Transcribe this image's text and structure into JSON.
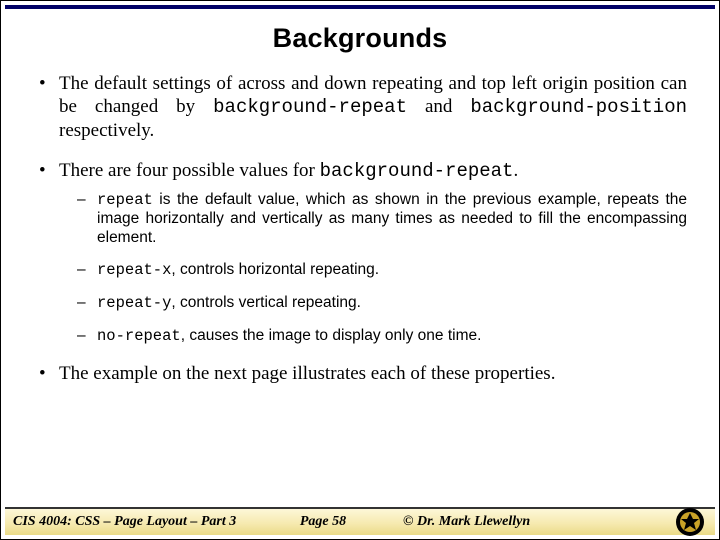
{
  "title": "Backgrounds",
  "bullets": {
    "b1": {
      "pre": "The default settings of across and down repeating and top left origin position can be changed by ",
      "code1": "background-repeat",
      "mid": " and ",
      "code2": "background-position",
      "post": " respectively."
    },
    "b2": {
      "pre": "There are four possible values for ",
      "code1": "background-repeat",
      "post": "."
    },
    "sub1": {
      "code": "repeat",
      "text": " is the default value, which as shown in the previous example, repeats the image horizontally and vertically as many times as needed to fill the encompassing element."
    },
    "sub2": {
      "code": "repeat-x",
      "text": ", controls horizontal repeating."
    },
    "sub3": {
      "code": "repeat-y",
      "text": ", controls vertical repeating."
    },
    "sub4": {
      "code": "no-repeat",
      "text": ", causes the image to display only one time."
    },
    "b3": "The example on the next page illustrates each of these properties."
  },
  "footer": {
    "course": "CIS 4004: CSS – Page Layout – Part 3",
    "page": "Page 58",
    "author": "© Dr. Mark Llewellyn"
  }
}
